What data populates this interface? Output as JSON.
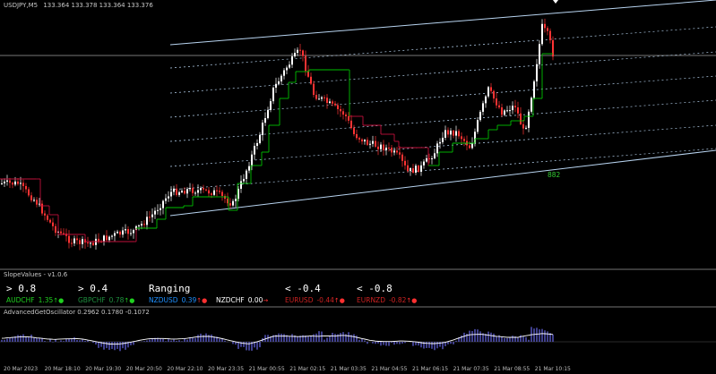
{
  "main": {
    "symbol": "USDJPY,M5",
    "ohlc": "133.364 133.378 133.364 133.376",
    "channel_label": "882",
    "colors": {
      "up": "#ffffff",
      "down": "#ff3333",
      "trail_up": "#00c000",
      "trail_down": "#c0103a",
      "channel": "#b8d4f0"
    }
  },
  "slope": {
    "title": "SlopeValues - v1.0.6",
    "levels": [
      "> 0.8",
      "> 0.4",
      "Ranging",
      "< -0.4",
      "< -0.8"
    ],
    "pairs": [
      {
        "name": "AUDCHF",
        "value": "1.35",
        "arrow": "↑",
        "dot": "●",
        "color": "#20d020",
        "arrow_color": "#20d020"
      },
      {
        "name": "GBPCHF",
        "value": "0.78",
        "arrow": "↑",
        "dot": "●",
        "color": "#1f8f3f",
        "arrow_color": "#20d020"
      },
      {
        "name": "NZDUSD",
        "value": "0.39",
        "arrow": "↑",
        "dot": "●",
        "color": "#1e90ff",
        "arrow_color": "#ff3030"
      },
      {
        "name": "NZDCHF",
        "value": "0.00",
        "arrow": "→",
        "dot": "",
        "color": "#ffffff",
        "arrow_color": "#ff3030"
      },
      {
        "name": "EURUSD",
        "value": "-0.44",
        "arrow": "↑",
        "dot": "●",
        "color": "#cc2222",
        "arrow_color": "#ff3030"
      },
      {
        "name": "EURNZD",
        "value": "-0.82",
        "arrow": "↑",
        "dot": "●",
        "color": "#cc2222",
        "arrow_color": "#ff3030"
      }
    ]
  },
  "osc": {
    "title": "AdvancedGetOscillator 0.2962 0.1780 -0.1072"
  },
  "time_axis": [
    "20 Mar 2023",
    "20 Mar 18:10",
    "20 Mar 19:30",
    "20 Mar 20:50",
    "20 Mar 22:10",
    "20 Mar 23:35",
    "21 Mar 00:55",
    "21 Mar 02:15",
    "21 Mar 03:35",
    "21 Mar 04:55",
    "21 Mar 06:15",
    "21 Mar 07:35",
    "21 Mar 08:55",
    "21 Mar 10:15"
  ]
}
